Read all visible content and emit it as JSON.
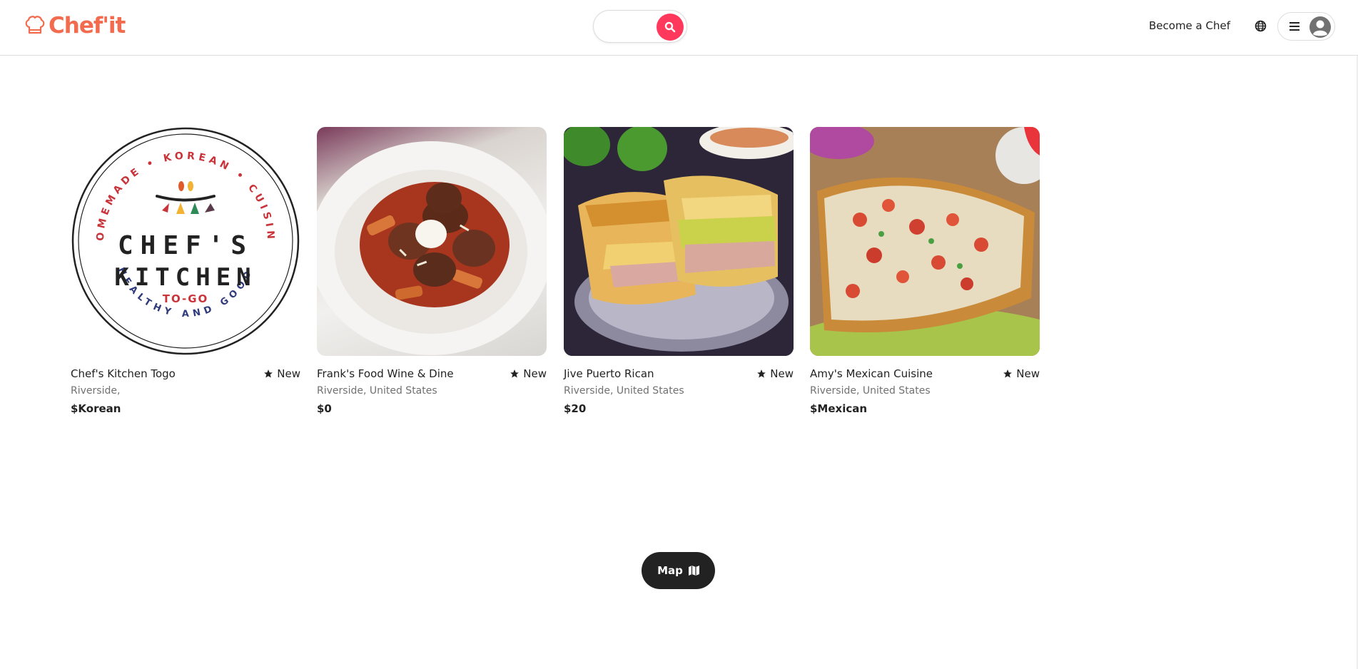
{
  "brand": {
    "name": "Chef'it",
    "logo_icon": "chef-hat-icon",
    "accent": "#f26b4f"
  },
  "search": {
    "button_color": "#ff385c",
    "icon": "search-icon"
  },
  "header": {
    "become_chef_label": "Become a Chef",
    "globe_icon": "globe-icon",
    "menu_icon": "hamburger-menu-icon",
    "avatar_icon": "user-avatar-icon"
  },
  "listings": [
    {
      "title": "Chef's Kitchen Togo",
      "rating_label": "New",
      "location": "Riverside,",
      "price": "$Korean",
      "logo_text": {
        "line1": "CHEF'S",
        "line2": "KITCHEN",
        "tag": "TO-GO",
        "arc_top": "HOMEMADE • KOREAN • CUISINE",
        "arc_bottom": "HEALTHY AND GOOD"
      }
    },
    {
      "title": "Frank's Food Wine & Dine",
      "rating_label": "New",
      "location": "Riverside, United States",
      "price": "$0"
    },
    {
      "title": "Jive Puerto Rican",
      "rating_label": "New",
      "location": "Riverside, United States",
      "price": "$20"
    },
    {
      "title": "Amy's Mexican Cuisine",
      "rating_label": "New",
      "location": "Riverside, United States",
      "price": "$Mexican"
    }
  ],
  "map_button": {
    "label": "Map",
    "icon": "map-icon"
  }
}
